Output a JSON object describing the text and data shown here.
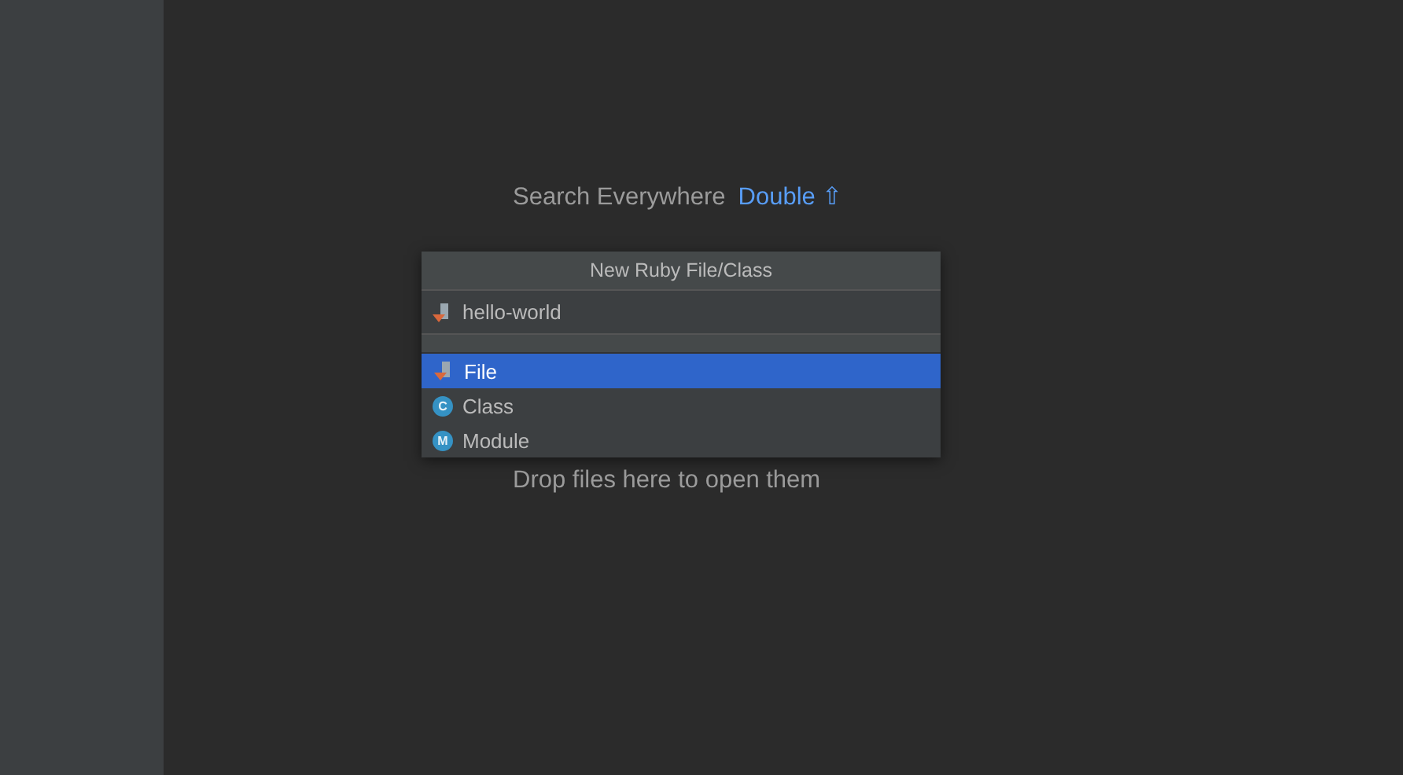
{
  "hints": [
    {
      "label": "Search Everywhere",
      "shortcut": "Double ⇧"
    }
  ],
  "drop_hint": "Drop files here to open them",
  "popup": {
    "title": "New Ruby File/Class",
    "name_field": {
      "value": "hello-world"
    },
    "items": [
      {
        "label": "File",
        "kind": "file",
        "selected": true
      },
      {
        "label": "Class",
        "kind": "class",
        "badge": "C",
        "selected": false
      },
      {
        "label": "Module",
        "kind": "module",
        "badge": "M",
        "selected": false
      }
    ]
  }
}
